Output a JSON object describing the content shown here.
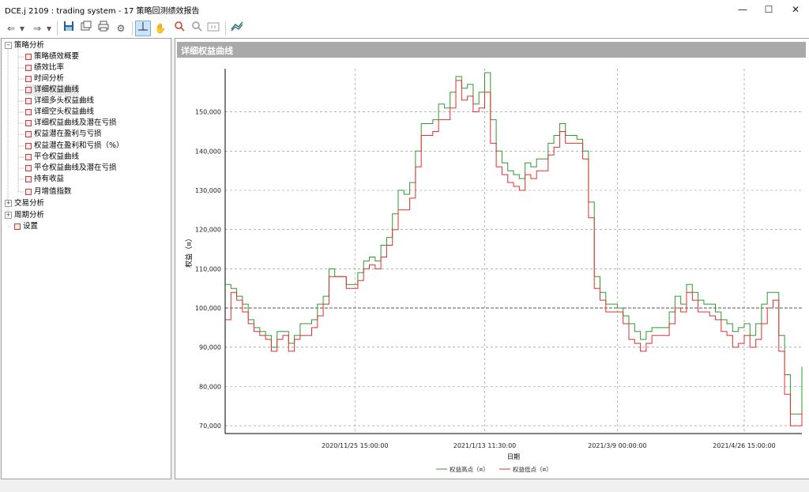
{
  "window": {
    "title": "DCE.j 2109 : trading system - 17 策略回测绩效报告",
    "minimize": "—",
    "maximize": "☐",
    "close": "✕"
  },
  "toolbar": {
    "icons": [
      "back-icon",
      "dropdown-icon",
      "forward-icon",
      "dropdown-icon",
      "save-icon",
      "export-icon",
      "print-icon",
      "settings-icon",
      "crosshair-icon",
      "pan-hand-icon",
      "zoom-in-icon",
      "zoom-out-icon",
      "zoom-fit-icon",
      "chart-style-icon"
    ],
    "active": "crosshair-icon"
  },
  "sidebar": {
    "groups": [
      {
        "label": "策略分析",
        "expanded": true,
        "children": [
          "策略绩效概要",
          "绩效比率",
          "时间分析",
          "详细权益曲线",
          "详细多头权益曲线",
          "详细空头权益曲线",
          "详细权益曲线及潜在亏损",
          "权益潜在盈利与亏损",
          "权益潜在盈利和亏损（%）",
          "平仓权益曲线",
          "平仓权益曲线及潜在亏损",
          "持有收益",
          "月增值指数"
        ]
      },
      {
        "label": "交易分析",
        "expanded": false
      },
      {
        "label": "周期分析",
        "expanded": false
      }
    ],
    "settings_label": "设置",
    "selected": "详细权益曲线"
  },
  "chart_panel": {
    "header": "详细权益曲线"
  },
  "chart_data": {
    "type": "line",
    "ylabel": "权益（¤）",
    "xlabel": "日期",
    "yticks": [
      70000,
      80000,
      90000,
      100000,
      110000,
      120000,
      130000,
      140000,
      150000
    ],
    "ytick_labels": [
      "70,000",
      "80,000",
      "90,000",
      "100,000",
      "110,000",
      "120,000",
      "130,000",
      "140,000",
      "150,000"
    ],
    "ylim": [
      68000,
      161000
    ],
    "xlim": [
      0,
      100
    ],
    "xticks": [
      22.5,
      45,
      68,
      90
    ],
    "xtick_labels": [
      "2020/11/25 15:00:00",
      "2021/1/13 11:30:00",
      "2021/3/9 00:00:00",
      "2021/4/26 15:00:00"
    ],
    "baseline": 100000,
    "grid": true,
    "legend_position": "bottom",
    "series": [
      {
        "name": "权益高点（¤）",
        "color": "#2e9a2e",
        "points": [
          [
            0,
            106000
          ],
          [
            1,
            105000
          ],
          [
            2,
            103000
          ],
          [
            3,
            101000
          ],
          [
            4,
            97000
          ],
          [
            5,
            95000
          ],
          [
            6,
            94000
          ],
          [
            7,
            93000
          ],
          [
            8,
            90000
          ],
          [
            9,
            94000
          ],
          [
            10,
            94000
          ],
          [
            11,
            91000
          ],
          [
            12,
            93000
          ],
          [
            13,
            96000
          ],
          [
            14,
            96000
          ],
          [
            15,
            97000
          ],
          [
            16,
            101000
          ],
          [
            17,
            103000
          ],
          [
            18,
            110000
          ],
          [
            19,
            108000
          ],
          [
            20,
            108000
          ],
          [
            21,
            106000
          ],
          [
            22,
            106000
          ],
          [
            23,
            109000
          ],
          [
            24,
            112000
          ],
          [
            25,
            113000
          ],
          [
            26,
            112000
          ],
          [
            27,
            116000
          ],
          [
            28,
            118000
          ],
          [
            29,
            124000
          ],
          [
            30,
            130000
          ],
          [
            31,
            129000
          ],
          [
            32,
            132000
          ],
          [
            33,
            140000
          ],
          [
            34,
            147000
          ],
          [
            35,
            147000
          ],
          [
            36,
            148000
          ],
          [
            37,
            152000
          ],
          [
            38,
            151000
          ],
          [
            39,
            155000
          ],
          [
            40,
            159000
          ],
          [
            41,
            156000
          ],
          [
            42,
            157000
          ],
          [
            43,
            152000
          ],
          [
            44,
            155000
          ],
          [
            45,
            160000
          ],
          [
            46,
            148000
          ],
          [
            47,
            140000
          ],
          [
            48,
            137000
          ],
          [
            49,
            135000
          ],
          [
            50,
            134000
          ],
          [
            51,
            133000
          ],
          [
            52,
            137000
          ],
          [
            53,
            136000
          ],
          [
            54,
            138000
          ],
          [
            55,
            138000
          ],
          [
            56,
            142000
          ],
          [
            57,
            144000
          ],
          [
            58,
            147000
          ],
          [
            59,
            144000
          ],
          [
            60,
            144000
          ],
          [
            61,
            143000
          ],
          [
            62,
            140000
          ],
          [
            63,
            127000
          ],
          [
            64,
            108000
          ],
          [
            65,
            104000
          ],
          [
            66,
            101000
          ],
          [
            67,
            101000
          ],
          [
            68,
            100000
          ],
          [
            69,
            98000
          ],
          [
            70,
            96000
          ],
          [
            71,
            94000
          ],
          [
            72,
            92000
          ],
          [
            73,
            94000
          ],
          [
            74,
            95000
          ],
          [
            75,
            95000
          ],
          [
            76,
            95000
          ],
          [
            77,
            99000
          ],
          [
            78,
            103000
          ],
          [
            79,
            101000
          ],
          [
            80,
            106000
          ],
          [
            81,
            104000
          ],
          [
            82,
            102000
          ],
          [
            83,
            101000
          ],
          [
            84,
            101000
          ],
          [
            85,
            99000
          ],
          [
            86,
            97000
          ],
          [
            87,
            96000
          ],
          [
            88,
            94000
          ],
          [
            89,
            95000
          ],
          [
            90,
            96000
          ],
          [
            91,
            93000
          ],
          [
            92,
            96000
          ],
          [
            93,
            101000
          ],
          [
            94,
            104000
          ],
          [
            95,
            104000
          ],
          [
            96,
            93000
          ],
          [
            97,
            83000
          ],
          [
            98,
            73000
          ],
          [
            99,
            73000
          ],
          [
            100,
            85000
          ]
        ]
      },
      {
        "name": "权益低点（¤）",
        "color": "#e03030",
        "points": [
          [
            0,
            97000
          ],
          [
            1,
            104000
          ],
          [
            2,
            102000
          ],
          [
            3,
            99000
          ],
          [
            4,
            96000
          ],
          [
            5,
            94000
          ],
          [
            6,
            93000
          ],
          [
            7,
            92000
          ],
          [
            8,
            89000
          ],
          [
            9,
            92000
          ],
          [
            10,
            93000
          ],
          [
            11,
            89000
          ],
          [
            12,
            92000
          ],
          [
            13,
            93000
          ],
          [
            14,
            93000
          ],
          [
            15,
            95000
          ],
          [
            16,
            98000
          ],
          [
            17,
            101000
          ],
          [
            18,
            108000
          ],
          [
            19,
            108000
          ],
          [
            20,
            108000
          ],
          [
            21,
            105000
          ],
          [
            22,
            105000
          ],
          [
            23,
            107000
          ],
          [
            24,
            110000
          ],
          [
            25,
            111000
          ],
          [
            26,
            110000
          ],
          [
            27,
            113000
          ],
          [
            28,
            116000
          ],
          [
            29,
            120000
          ],
          [
            30,
            125000
          ],
          [
            31,
            125000
          ],
          [
            32,
            128000
          ],
          [
            33,
            136000
          ],
          [
            34,
            144000
          ],
          [
            35,
            144000
          ],
          [
            36,
            145000
          ],
          [
            37,
            148000
          ],
          [
            38,
            148000
          ],
          [
            39,
            151000
          ],
          [
            40,
            158000
          ],
          [
            41,
            153000
          ],
          [
            42,
            154000
          ],
          [
            43,
            150000
          ],
          [
            44,
            151000
          ],
          [
            45,
            155000
          ],
          [
            46,
            142000
          ],
          [
            47,
            136000
          ],
          [
            48,
            134000
          ],
          [
            49,
            132000
          ],
          [
            50,
            131000
          ],
          [
            51,
            130000
          ],
          [
            52,
            134000
          ],
          [
            53,
            133000
          ],
          [
            54,
            135000
          ],
          [
            55,
            135000
          ],
          [
            56,
            139000
          ],
          [
            57,
            141000
          ],
          [
            58,
            145000
          ],
          [
            59,
            142000
          ],
          [
            60,
            142000
          ],
          [
            61,
            142000
          ],
          [
            62,
            138000
          ],
          [
            63,
            123000
          ],
          [
            64,
            105000
          ],
          [
            65,
            102000
          ],
          [
            66,
            99000
          ],
          [
            67,
            99000
          ],
          [
            68,
            99000
          ],
          [
            69,
            96000
          ],
          [
            70,
            92000
          ],
          [
            71,
            91000
          ],
          [
            72,
            89000
          ],
          [
            73,
            91000
          ],
          [
            74,
            93000
          ],
          [
            75,
            93000
          ],
          [
            76,
            93000
          ],
          [
            77,
            96000
          ],
          [
            78,
            100000
          ],
          [
            79,
            99000
          ],
          [
            80,
            104000
          ],
          [
            81,
            102000
          ],
          [
            82,
            99000
          ],
          [
            83,
            99000
          ],
          [
            84,
            98000
          ],
          [
            85,
            97000
          ],
          [
            86,
            94000
          ],
          [
            87,
            93000
          ],
          [
            88,
            90000
          ],
          [
            89,
            91000
          ],
          [
            90,
            93000
          ],
          [
            91,
            90000
          ],
          [
            92,
            92000
          ],
          [
            93,
            96000
          ],
          [
            94,
            100000
          ],
          [
            95,
            102000
          ],
          [
            96,
            89000
          ],
          [
            97,
            78000
          ],
          [
            98,
            70000
          ],
          [
            99,
            70000
          ],
          [
            100,
            74000
          ]
        ]
      }
    ]
  }
}
